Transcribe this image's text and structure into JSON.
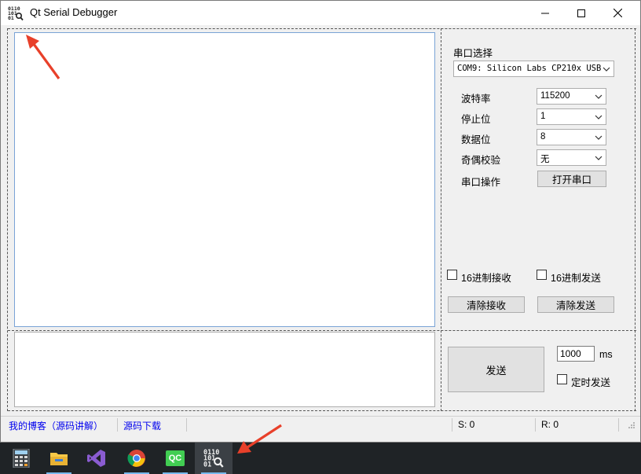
{
  "window": {
    "title": "Qt Serial Debugger"
  },
  "settings": {
    "port_select_label": "串口选择",
    "port_value": "COM9: Silicon Labs CP210x USB",
    "baud_label": "波特率",
    "baud_value": "115200",
    "stop_label": "停止位",
    "stop_value": "1",
    "data_label": "数据位",
    "data_value": "8",
    "parity_label": "奇偶校验",
    "parity_value": "无",
    "op_label": "串口操作",
    "open_button": "打开串口"
  },
  "options": {
    "hex_receive_label": "16进制接收",
    "hex_send_label": "16进制发送",
    "clear_receive_button": "清除接收",
    "clear_send_button": "清除发送"
  },
  "send_panel": {
    "send_button": "发送",
    "interval_value": "1000",
    "interval_unit": "ms",
    "timed_send_label": "定时发送"
  },
  "statusbar": {
    "blog_link": "我的博客（源码讲解）",
    "download_link": "源码下载",
    "sent": "S: 0",
    "received": "R: 0"
  },
  "taskbar": {
    "icons": [
      "calculator-icon",
      "file-explorer-icon",
      "visual-studio-icon",
      "chrome-icon",
      "qt-creator-icon",
      "serial-debugger-icon"
    ],
    "qt_creator_text": "QC"
  },
  "colors": {
    "annotation_arrow": "#e8402a",
    "link": "#0000ee",
    "taskbar": "#1f2326",
    "recv_border": "#7aa3d6"
  }
}
